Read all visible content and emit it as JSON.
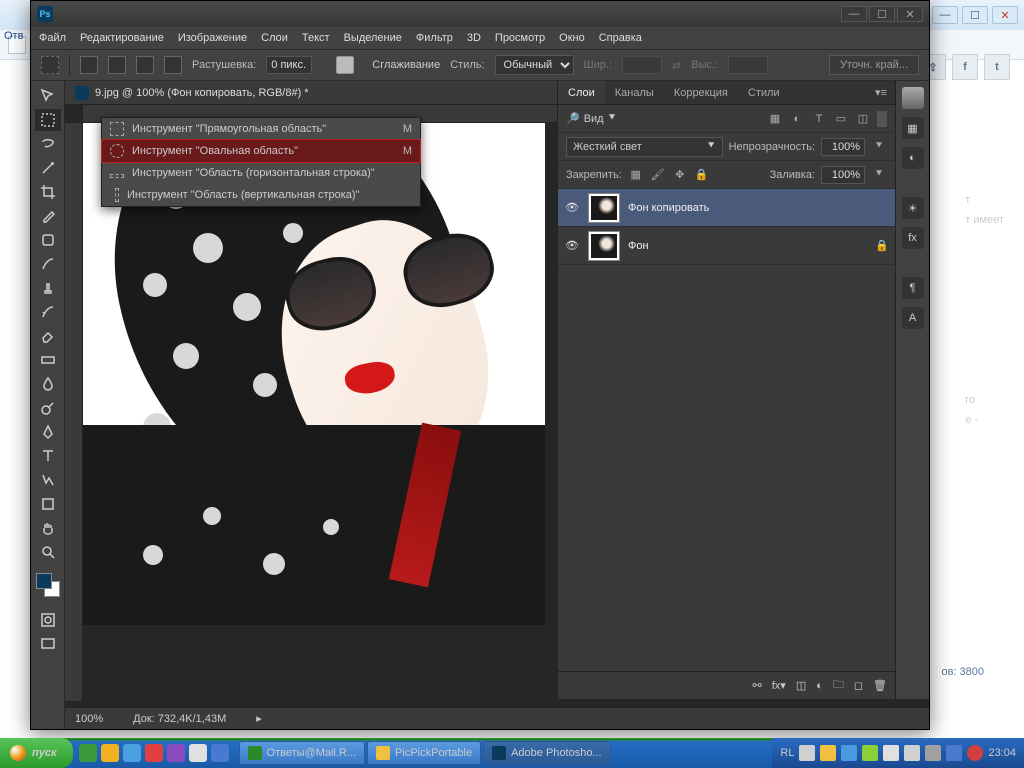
{
  "browser": {
    "answers_label": "Отв"
  },
  "ps": {
    "logo": "Ps",
    "menu": [
      "Файл",
      "Редактирование",
      "Изображение",
      "Слои",
      "Текст",
      "Выделение",
      "Фильтр",
      "3D",
      "Просмотр",
      "Окно",
      "Справка"
    ],
    "options": {
      "feather_label": "Растушевка:",
      "feather_value": "0 пикс.",
      "antialias": "Сглаживание",
      "style_label": "Стиль:",
      "style_value": "Обычный",
      "width_label": "Шир.:",
      "height_label": "Выс.:",
      "refine": "Уточн. край..."
    },
    "doc_title": "9.jpg @ 100% (Фон копировать, RGB/8#) *",
    "status": {
      "zoom": "100%",
      "doc": "Док: 732,4K/1,43M"
    },
    "flyout": [
      {
        "label": "Инструмент \"Прямоугольная область\"",
        "shortcut": "M",
        "shape": "rect"
      },
      {
        "label": "Инструмент \"Овальная область\"",
        "shortcut": "M",
        "shape": "ell",
        "hl": true
      },
      {
        "label": "Инструмент \"Область (горизонтальная строка)\"",
        "shortcut": "",
        "shape": "row"
      },
      {
        "label": "Инструмент \"Область (вертикальная строка)\"",
        "shortcut": "",
        "shape": "col"
      }
    ]
  },
  "panels": {
    "tabs": [
      "Слои",
      "Каналы",
      "Коррекция",
      "Стили"
    ],
    "kind": "Вид",
    "blend": "Жесткий свет",
    "opacity_label": "Непрозрачность:",
    "opacity_value": "100%",
    "lock_label": "Закрепить:",
    "fill_label": "Заливка:",
    "fill_value": "100%",
    "layers": [
      {
        "name": "Фон копировать",
        "selected": true,
        "locked": false
      },
      {
        "name": "Фон",
        "selected": false,
        "locked": true
      }
    ]
  },
  "side": {
    "line1": "т",
    "line2": "т имеет",
    "line3": "го",
    "line4": "е -",
    "views": "ов: 3800"
  },
  "taskbar": {
    "start": "пуск",
    "lang": "RL",
    "time": "23:04",
    "buttons": [
      {
        "label": "Ответы@Mail.R...",
        "icon": "#2a8a2a"
      },
      {
        "label": "PicPickPortable",
        "icon": "#f0c040"
      },
      {
        "label": "Adobe Photosho...",
        "icon": "#0a3a5c",
        "active": true
      }
    ]
  }
}
